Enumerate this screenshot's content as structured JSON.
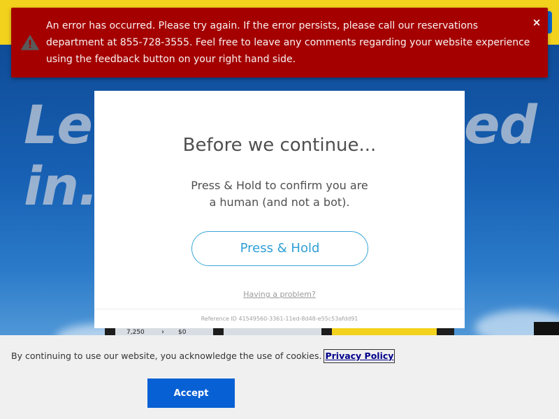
{
  "error": {
    "message": "An error has occurred. Please try again. If the error persists, please call our reservations department at 855-728-3555. Feel free to leave any comments regarding your website experience using the feedback button on your right hand side.",
    "close_glyph": "×"
  },
  "hero": {
    "line1": "Let",
    "line1_end": "ed",
    "line2": "in."
  },
  "device": {
    "amount_a": "7,250",
    "arrow": "›",
    "amount_b": "$0"
  },
  "modal": {
    "title": "Before we continue...",
    "message_line1": "Press & Hold to confirm you are",
    "message_line2": "a human (and not a bot).",
    "button_label": "Press & Hold",
    "problem_link": "Having a problem?",
    "reference": "Reference ID 41549560-3361-11ed-8d48-e55c53afdd91"
  },
  "cookie": {
    "text": "By continuing to use our website, you acknowledge the use of cookies.",
    "link": "Privacy Policy",
    "accept": "Accept"
  },
  "colors": {
    "brand_yellow": "#f3d21d",
    "brand_blue": "#0760d4",
    "error_red": "#a40000",
    "accent_cyan": "#2f9fd6"
  }
}
